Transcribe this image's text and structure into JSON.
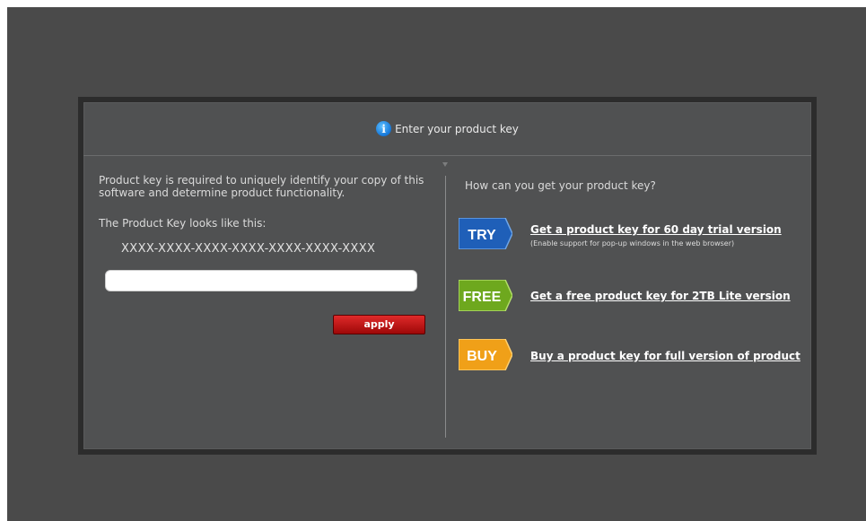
{
  "dialog": {
    "title": "Enter your product key",
    "info_icon": "info-icon"
  },
  "left": {
    "description": "Product key is required to uniquely identify your copy of this software and determine product functionality.",
    "key_format_label": "The Product Key looks like this:",
    "key_format_sample": "XXXX-XXXX-XXXX-XXXX-XXXX-XXXX-XXXX",
    "key_input_value": "",
    "apply_label": "apply"
  },
  "right": {
    "heading": "How can you get your product key?",
    "options": [
      {
        "badge": "TRY",
        "color": "#1f5fb8",
        "link": "Get a product key for 60 day trial version",
        "note": "(Enable support for pop-up windows in the web browser)"
      },
      {
        "badge": "FREE",
        "color": "#6ea81e",
        "link": "Get a free product key for 2TB Lite version",
        "note": ""
      },
      {
        "badge": "BUY",
        "color": "#f0a018",
        "link": "Buy a product key for full version of product",
        "note": ""
      }
    ]
  }
}
